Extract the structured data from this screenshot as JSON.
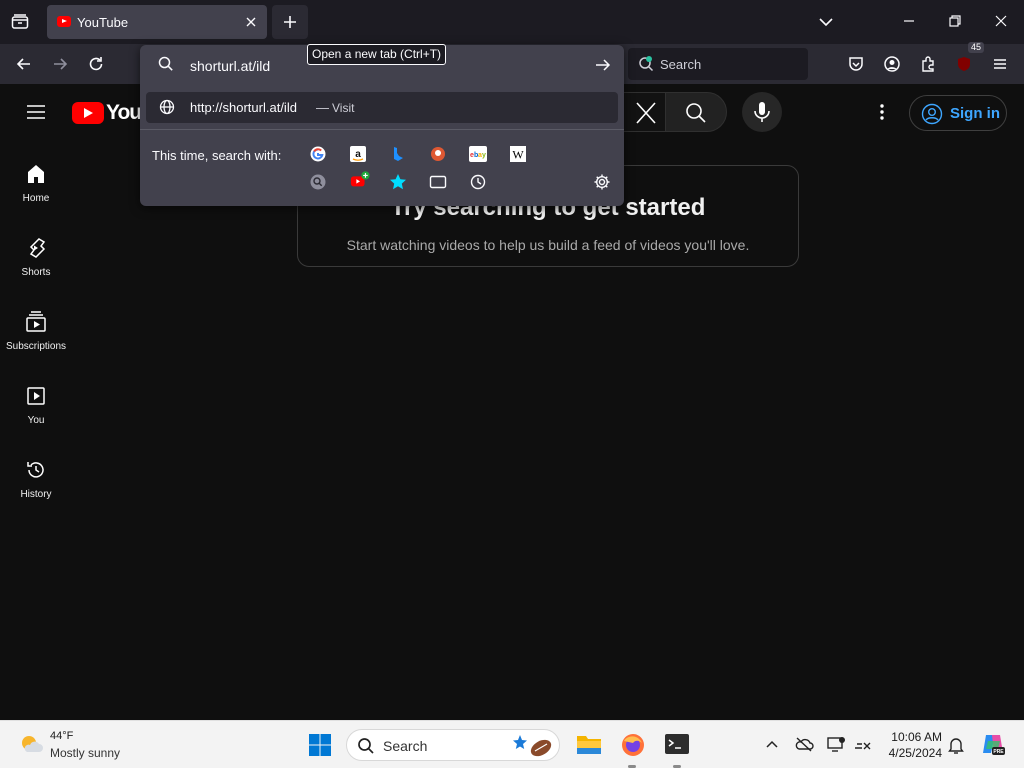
{
  "browser": {
    "tab_title": "YouTube",
    "url_value": "shorturl.at/ild",
    "tooltip": "Open a new tab (Ctrl+T)",
    "search_placeholder": "Search",
    "extension_badge": "45",
    "suggestion_url": "http://shorturl.at/ild",
    "suggestion_sep": "—",
    "suggestion_action": "Visit",
    "search_with_label": "This time, search with:",
    "engines": [
      "google-icon",
      "amazon-icon",
      "bing-icon",
      "duckduckgo-icon",
      "ebay-icon",
      "wikipedia-icon"
    ],
    "modes": [
      "history-search-icon",
      "youtube-addon-icon",
      "bookmarks-icon",
      "tabs-icon",
      "history-icon",
      "settings-icon"
    ]
  },
  "youtube": {
    "logo_text": "YouTube",
    "signin_label": "Sign in",
    "sidebar": [
      {
        "label": "Home",
        "icon": "home-icon"
      },
      {
        "label": "Shorts",
        "icon": "shorts-icon"
      },
      {
        "label": "Subscriptions",
        "icon": "subscriptions-icon"
      },
      {
        "label": "You",
        "icon": "you-icon"
      },
      {
        "label": "History",
        "icon": "history-icon"
      }
    ],
    "card_heading": "Try searching to get started",
    "card_sub": "Start watching videos to help us build a feed of videos you'll love."
  },
  "taskbar": {
    "temp": "44°F",
    "condition": "Mostly sunny",
    "search_label": "Search",
    "time": "10:06 AM",
    "date": "4/25/2024"
  },
  "colors": {
    "accent": "#3ea6ff",
    "yt_red": "#ff0000",
    "firefox_dark": "#2b2a33"
  }
}
